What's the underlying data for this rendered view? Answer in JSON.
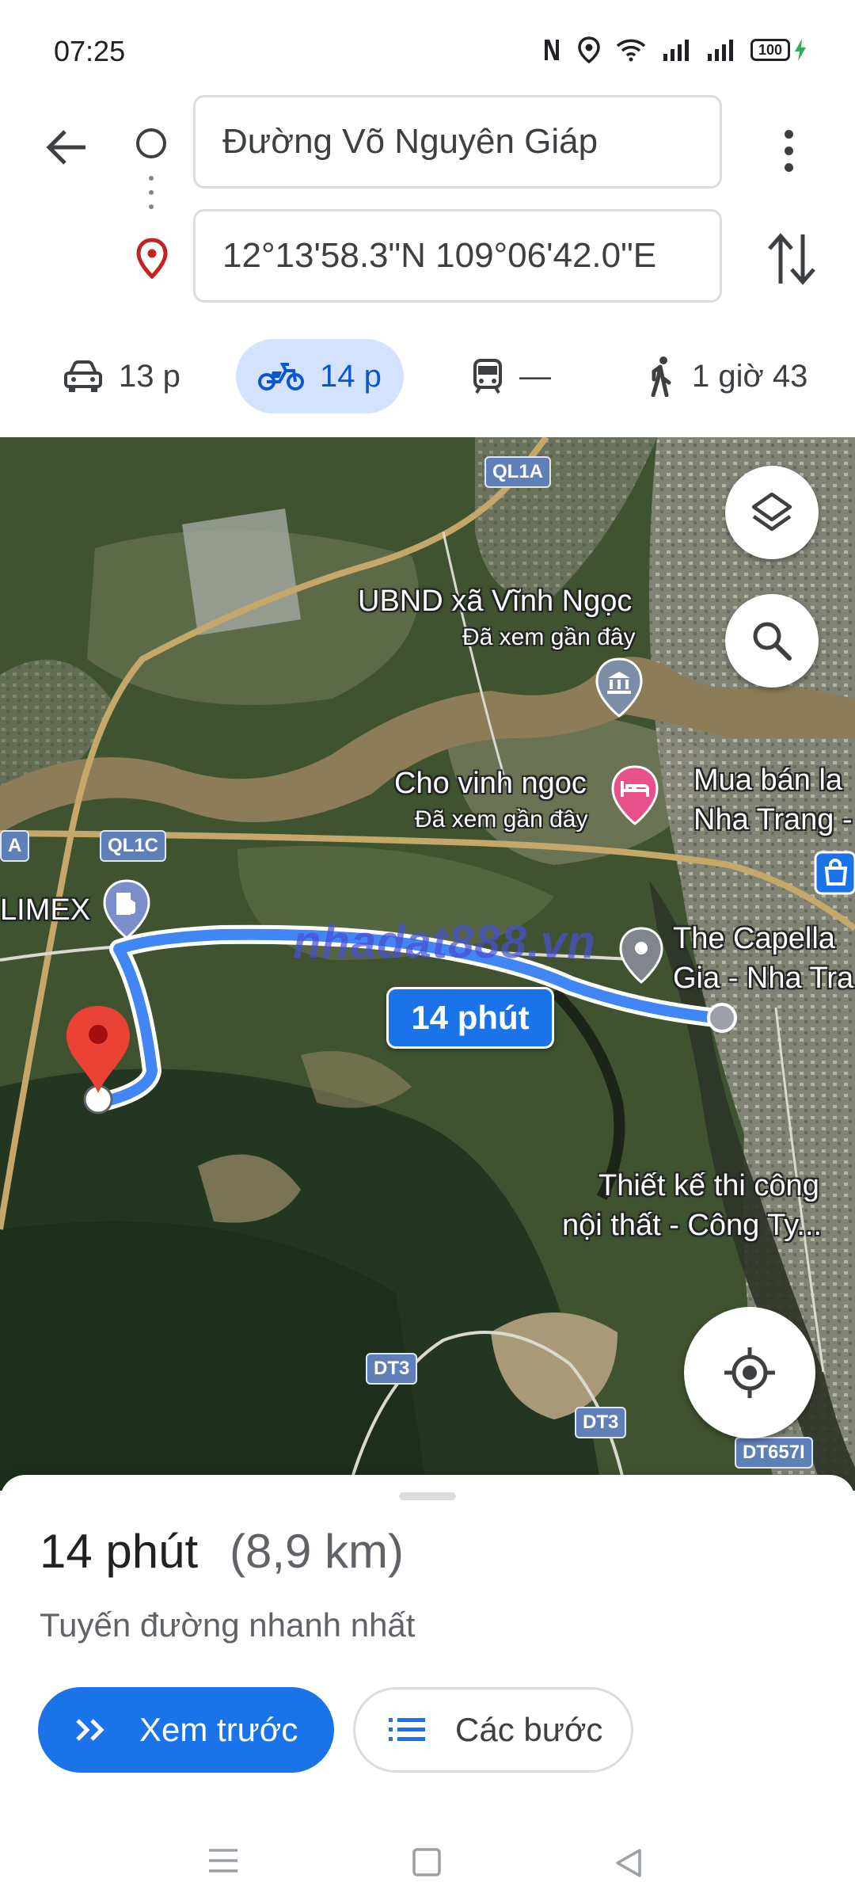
{
  "status_bar": {
    "time": "07:25",
    "battery": "100",
    "icons": [
      "nfc-icon",
      "location-icon",
      "wifi-icon",
      "signal-icon",
      "signal-icon",
      "battery-icon",
      "charging-icon"
    ]
  },
  "directions": {
    "origin": "Đường Võ Nguyên Giáp",
    "destination": "12°13'58.3\"N 109°06'42.0\"E"
  },
  "modes": [
    {
      "icon": "car-icon",
      "label": "13 p"
    },
    {
      "icon": "motorbike-icon",
      "label": "14 p",
      "active": true
    },
    {
      "icon": "transit-icon",
      "label": "—"
    },
    {
      "icon": "walk-icon",
      "label": "1 giờ 43"
    }
  ],
  "map": {
    "roads": [
      "QL1A",
      "QL1C",
      "A",
      "DT3",
      "DT3",
      "DT657I"
    ],
    "places": [
      {
        "name": "UBND xã Vĩnh Ngọc",
        "note": "Đã xem gần đây"
      },
      {
        "name": "Cho vinh ngoc",
        "note": "Đã xem gần đây"
      },
      {
        "name": "Mua bán la",
        "line2": "Nha Trang -"
      },
      {
        "name": "LIMEX"
      },
      {
        "name": "The Capella",
        "line2": "Gia - Nha Tra"
      },
      {
        "name": "Thiết kế thi công",
        "line2": "nội thất - Công Ty..."
      }
    ],
    "route_badge": "14 phút",
    "watermark": "nhadat888.vn",
    "route_color": "#4285f4"
  },
  "sheet": {
    "duration": "14 phút",
    "distance": "(8,9 km)",
    "subtitle": "Tuyến đường nhanh nhất",
    "preview_label": "Xem trước",
    "steps_label": "Các bước"
  },
  "colors": {
    "accent": "#1a73e8",
    "active_mode_bg": "#d3e3fd",
    "pin_red": "#ea4335"
  }
}
